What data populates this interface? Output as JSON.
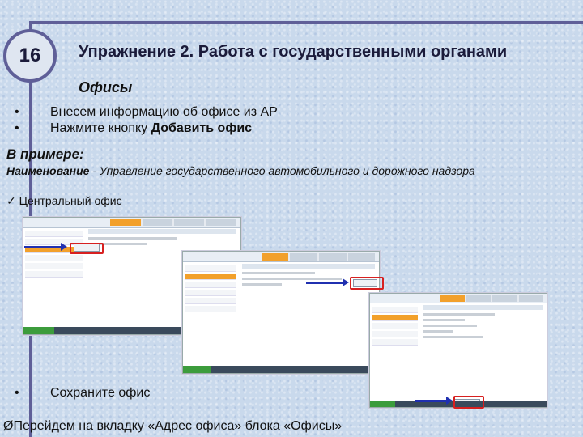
{
  "slide_number": "16",
  "title": "Упражнение 2. Работа с государственными органами",
  "subtitle": "Офисы",
  "bullets": [
    {
      "prefix": "Внесем информацию об офисе из АР",
      "bold": ""
    },
    {
      "prefix": "Нажмите кнопку ",
      "bold": "Добавить офис"
    }
  ],
  "example_heading": "В примере:",
  "example_label": "Наименование",
  "example_value": " - Управление государственного автомобильного и дорожного надзора",
  "checkmark_item": "✓  Центральный офис",
  "bottom_bullet": "Сохраните офис",
  "goto_text": "Перейдем на вкладку «Адрес офиса» блока «Офисы»",
  "goto_marker": "Ø",
  "bullet_glyph": "•",
  "colors": {
    "frame": "#5f5f98",
    "highlight": "#d72020",
    "arrow": "#2030b0",
    "active_tab": "#f2a02b"
  }
}
